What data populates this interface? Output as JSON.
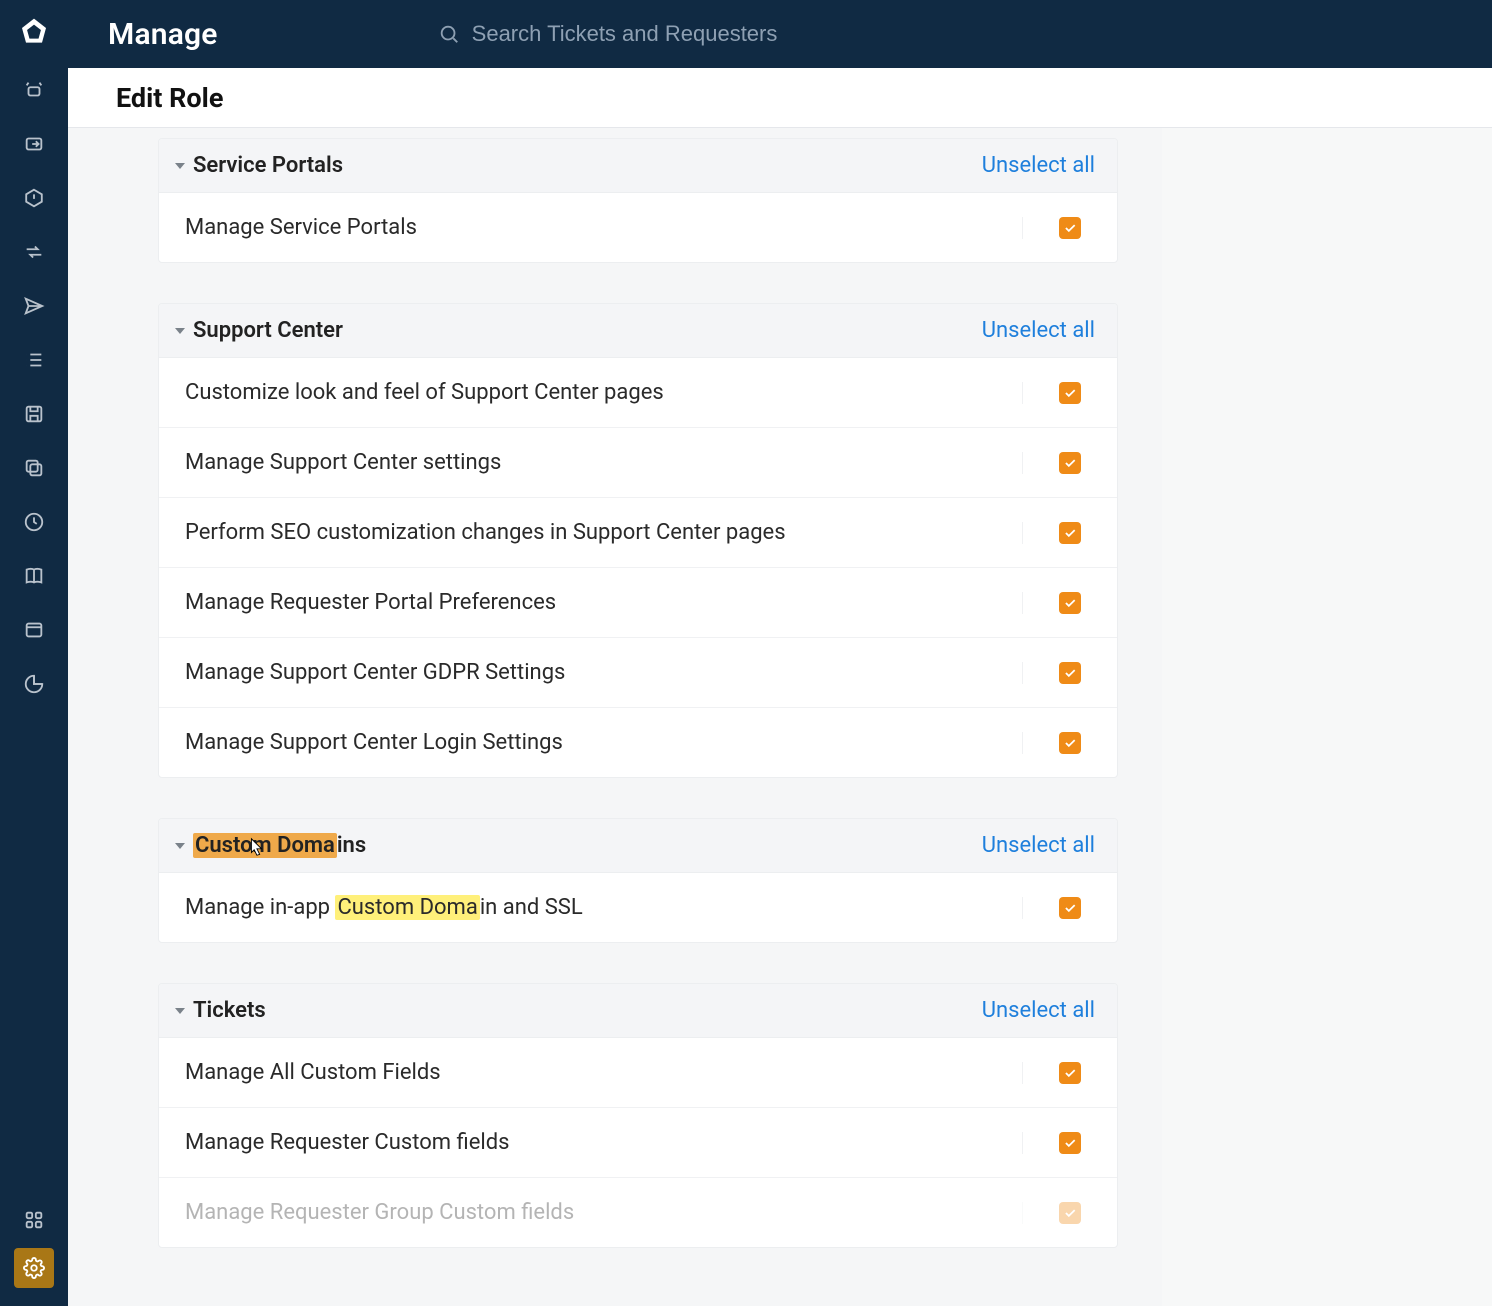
{
  "header": {
    "app_title": "Manage"
  },
  "search": {
    "placeholder": "Search Tickets and Requesters"
  },
  "page": {
    "title": "Edit Role"
  },
  "colors": {
    "accent": "#ef8b17",
    "link": "#1e7fdc",
    "sidebar_bg": "#102a43"
  },
  "sections": {
    "service_portals": {
      "title": "Service Portals",
      "action": "Unselect all",
      "perms": [
        {
          "label": "Manage Service Portals",
          "checked": true
        }
      ]
    },
    "support_center": {
      "title": "Support Center",
      "action": "Unselect all",
      "perms": [
        {
          "label": "Customize look and feel of Support Center pages",
          "checked": true
        },
        {
          "label": "Manage Support Center settings",
          "checked": true
        },
        {
          "label": "Perform SEO customization changes in Support Center pages",
          "checked": true
        },
        {
          "label": "Manage Requester Portal Preferences",
          "checked": true
        },
        {
          "label": "Manage Support Center GDPR Settings",
          "checked": true
        },
        {
          "label": "Manage Support Center Login Settings",
          "checked": true
        }
      ]
    },
    "custom_domains": {
      "title_plain": "Custom Domains",
      "title_pre_hl": "Custom Doma",
      "title_post": "ins",
      "action": "Unselect all",
      "perm_pre": "Manage in-app ",
      "perm_hl": "Custom Doma",
      "perm_post": "in and SSL",
      "checked": true
    },
    "tickets": {
      "title": "Tickets",
      "action": "Unselect all",
      "perms": [
        {
          "label": "Manage All Custom Fields",
          "checked": true
        },
        {
          "label": "Manage Requester Custom fields",
          "checked": true
        },
        {
          "label": "Manage Requester Group Custom fields",
          "checked": true
        }
      ]
    }
  },
  "sidebar_icons": [
    "alarm-icon",
    "inbox-arrow-icon",
    "alert-icon",
    "swap-icon",
    "send-icon",
    "list-icon",
    "save-icon",
    "copy-icon",
    "clock-icon",
    "book-icon",
    "window-icon",
    "pie-icon"
  ]
}
